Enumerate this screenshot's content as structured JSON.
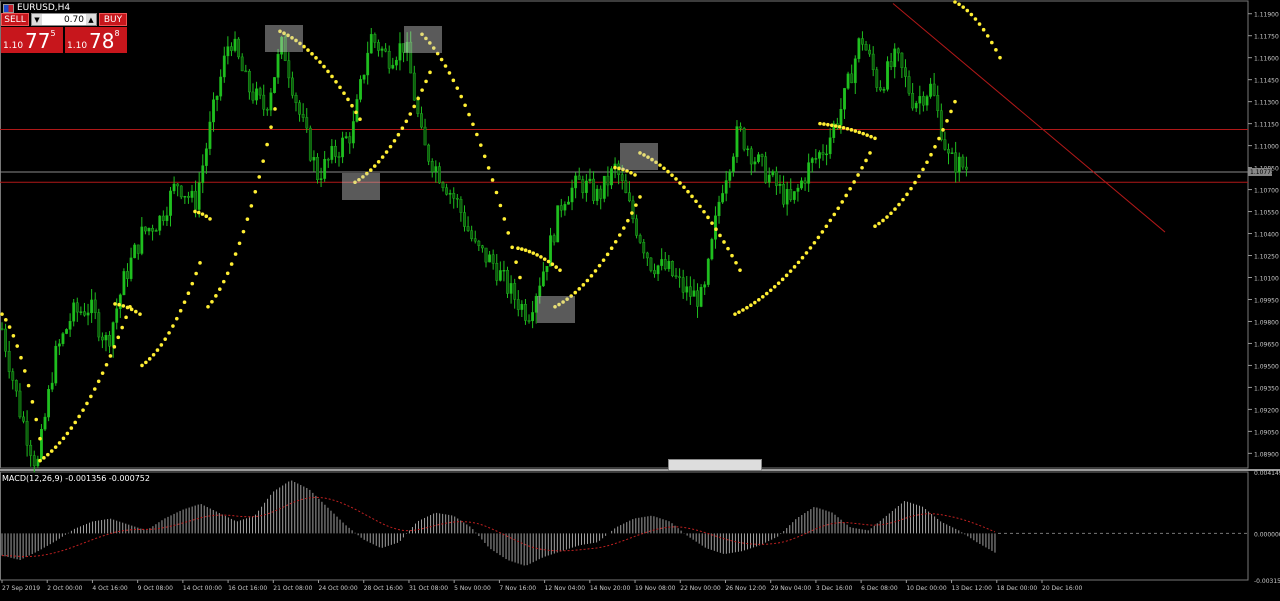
{
  "symbol": {
    "name": "EURUSD,H4",
    "icon": "eu-flag-icon"
  },
  "trade_panel": {
    "sell_label": "SELL",
    "buy_label": "BUY",
    "lot_value": "0.70",
    "sell_price": {
      "prefix": "1.10",
      "big": "77",
      "sup": "5"
    },
    "buy_price": {
      "prefix": "1.10",
      "big": "78",
      "sup": "8"
    }
  },
  "chart_data": [
    {
      "type": "candlestick",
      "title": "EURUSD,H4",
      "y_ticks": [
        "1.11900",
        "1.11750",
        "1.11600",
        "1.11450",
        "1.11300",
        "1.11150",
        "1.11000",
        "1.10850",
        "1.10700",
        "1.10550",
        "1.10400",
        "1.10250",
        "1.10100",
        "1.09950",
        "1.09800",
        "1.09650",
        "1.09500",
        "1.09350",
        "1.09200",
        "1.09050",
        "1.08900"
      ],
      "ylim": [
        1.088,
        1.1198
      ],
      "x_ticks": [
        "27 Sep 2019",
        "2 Oct 00:00",
        "4 Oct 16:00",
        "9 Oct 08:00",
        "14 Oct 00:00",
        "16 Oct 16:00",
        "21 Oct 08:00",
        "24 Oct 00:00",
        "28 Oct 16:00",
        "31 Oct 08:00",
        "5 Nov 00:00",
        "7 Nov 16:00",
        "12 Nov 04:00",
        "14 Nov 20:00",
        "19 Nov 08:00",
        "22 Nov 00:00",
        "26 Nov 12:00",
        "29 Nov 04:00",
        "3 Dec 16:00",
        "6 Dec 08:00",
        "10 Dec 00:00",
        "13 Dec 12:00",
        "18 Dec 00:00",
        "20 Dec 16:00"
      ],
      "price_path": [
        1.0975,
        1.092,
        1.088,
        1.0955,
        1.0985,
        1.099,
        1.0965,
        1.101,
        1.104,
        1.105,
        1.1075,
        1.106,
        1.112,
        1.1175,
        1.114,
        1.1125,
        1.117,
        1.112,
        1.108,
        1.1095,
        1.111,
        1.1175,
        1.116,
        1.117,
        1.11,
        1.108,
        1.106,
        1.103,
        1.102,
        1.1,
        1.0985,
        1.102,
        1.1065,
        1.1075,
        1.1065,
        1.1085,
        1.105,
        1.102,
        1.1015,
        1.1,
        1.0995,
        1.107,
        1.111,
        1.109,
        1.1075,
        1.106,
        1.1085,
        1.11,
        1.113,
        1.1175,
        1.114,
        1.116,
        1.113,
        1.114,
        1.109,
        1.1085
      ],
      "horizontal_lines": [
        1.1111,
        1.1082,
        1.1075
      ],
      "current_price_label": "1.10775",
      "trendline": {
        "from": [
          "13 Dec 12:00",
          1.1197
        ],
        "to": [
          "26 Dec",
          1.104
        ]
      },
      "parabolic_sar": "yellow dots",
      "series_color": "#1fbf1f"
    },
    {
      "type": "histogram",
      "title": "MACD(12,26,9) -0.001356 -0.000752",
      "y_ticks": [
        "0.004149",
        "0.000000",
        "-0.003151"
      ],
      "ylim": [
        -0.003151,
        0.004149
      ],
      "values": [
        -0.0015,
        -0.0018,
        -0.0012,
        -0.0005,
        0.0003,
        0.0008,
        0.001,
        0.0006,
        0.0002,
        0.001,
        0.0016,
        0.002,
        0.0014,
        0.0008,
        0.0012,
        0.0028,
        0.0036,
        0.003,
        0.0018,
        0.0006,
        -0.0004,
        -0.001,
        -0.0006,
        0.0008,
        0.0014,
        0.0012,
        0.0004,
        -0.001,
        -0.0018,
        -0.0022,
        -0.0016,
        -0.0012,
        -0.0008,
        -0.0006,
        0.0004,
        0.001,
        0.0012,
        0.0008,
        -0.0002,
        -0.001,
        -0.0014,
        -0.0012,
        -0.0008,
        -0.0002,
        0.001,
        0.0018,
        0.0014,
        0.0004,
        0.0002,
        0.0012,
        0.0022,
        0.0018,
        0.0008,
        0.0002,
        -0.0006,
        -0.0013
      ],
      "series_color": "#a0a0a0",
      "signal_color": "#c02020"
    }
  ],
  "colors": {
    "bull": "#1fbf1f",
    "sar": "#ffee33",
    "hline": "#b01818",
    "grid_text": "#c8c8c8"
  }
}
